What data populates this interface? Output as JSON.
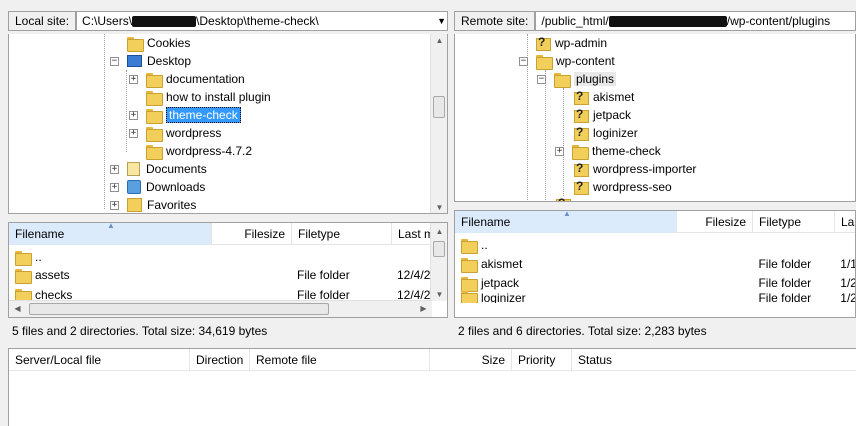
{
  "local": {
    "site_label": "Local site:",
    "path_start": "C:\\Users\\",
    "path_end": "\\Desktop\\theme-check\\",
    "tree": [
      "Cookies",
      "Desktop",
      "documentation",
      "how to install plugin",
      "theme-check",
      "wordpress",
      "wordpress-4.7.2",
      "Documents",
      "Downloads",
      "Favorites"
    ],
    "columns": [
      "Filename",
      "Filesize",
      "Filetype",
      "Last m"
    ],
    "files": [
      {
        "name": "..",
        "type": "",
        "date": ""
      },
      {
        "name": "assets",
        "type": "File folder",
        "date": "12/4/2"
      },
      {
        "name": "checks",
        "type": "File folder",
        "date": "12/4/2"
      }
    ],
    "status": "5 files and 2 directories. Total size: 34,619 bytes"
  },
  "remote": {
    "site_label": "Remote site:",
    "path_start": "/public_html/",
    "path_end": "/wp-content/plugins",
    "tree": [
      "wp-admin",
      "wp-content",
      "plugins",
      "akismet",
      "jetpack",
      "loginizer",
      "theme-check",
      "wordpress-importer",
      "wordpress-seo"
    ],
    "columns": [
      "Filename",
      "Filesize",
      "Filetype",
      "Las"
    ],
    "files": [
      {
        "name": "..",
        "type": "",
        "date": ""
      },
      {
        "name": "akismet",
        "type": "File folder",
        "date": "1/1"
      },
      {
        "name": "jetpack",
        "type": "File folder",
        "date": "1/2"
      },
      {
        "name": "loginizer",
        "type": "File folder",
        "date": "1/2"
      }
    ],
    "status": "2 files and 6 directories. Total size: 2,283 bytes"
  },
  "queue": {
    "columns": [
      "Server/Local file",
      "Direction",
      "Remote file",
      "Size",
      "Priority",
      "Status"
    ]
  },
  "colors": {
    "selection": "#3399ff",
    "sorted_header": "#dcebfc",
    "folder": "#f2cf5a"
  }
}
